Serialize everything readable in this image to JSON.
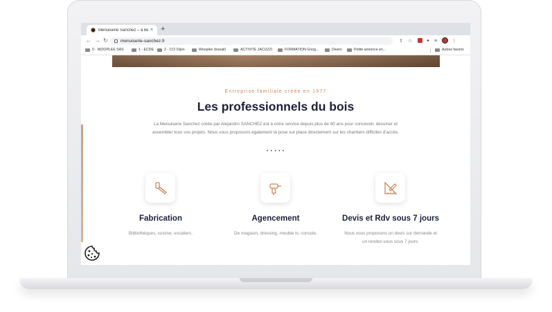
{
  "browser": {
    "tab_title": "Menuiserie Sanchez – à Besançon",
    "tab_close": "×",
    "new_tab": "+",
    "url": "menuiserie-sanchez.fr",
    "bookmarks": [
      "0 - WOOPLEE SAS",
      "1 - ECDE",
      "2 - CCI Dijon",
      "Wooplee (travail)",
      "ACTIVITE JACUZZI",
      "FORMATION Goog...",
      "Divers",
      "Petite annonce en...",
      "Autres favoris"
    ]
  },
  "page": {
    "subtitle": "Entreprise familiale créée en 1977",
    "headline": "Les professionnels du bois",
    "intro": "La Menuiserie Sanchez créée par Alejandro SANCHEZ est à votre service depuis plus de 40 ans pour concevoir, dessiner et assembler tous vos projets. Nous vous proposons également la pose sur place directement sur les chantiers difficiles d'accès.",
    "dots": "• • • • •",
    "features": [
      {
        "title": "Fabrication",
        "desc": "Bibliothèques, cuisine, escaliers.",
        "icon": "saw-icon"
      },
      {
        "title": "Agencement",
        "desc": "De magasin, dressing, meuble tv, console.",
        "icon": "drill-icon"
      },
      {
        "title": "Devis et Rdv sous 7 jours",
        "desc": "Nous vous proposons un devis sur demande et un rendez-vous sous 7 jours.",
        "icon": "ruler-pencil-icon"
      }
    ]
  },
  "colors": {
    "accent": "#c8875a",
    "heading": "#1c2038",
    "text": "#777777"
  }
}
